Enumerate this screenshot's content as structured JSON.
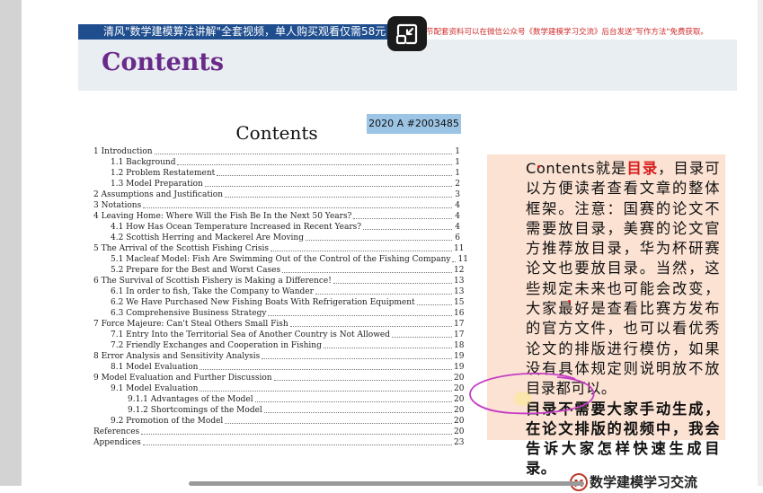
{
  "banner": {
    "text": "清风\"数学建模算法讲解\"全套视频，单人购买观看仅需58元",
    "note": "节配套资料可以在微信公众号《数学建模学习交流》后台发送\"写作方法\"免费获取。"
  },
  "slide": {
    "title": "Contents",
    "badge": "2020 A #2003485",
    "doc_title": "Contents"
  },
  "toc": [
    {
      "text": "1 Introduction",
      "page": "1",
      "level": 0
    },
    {
      "text": "1.1 Background",
      "page": "1",
      "level": 1
    },
    {
      "text": "1.2 Problem Restatement",
      "page": "1",
      "level": 1
    },
    {
      "text": "1.3 Model Preparation",
      "page": "2",
      "level": 1
    },
    {
      "text": "2 Assumptions and Justification",
      "page": "3",
      "level": 0
    },
    {
      "text": "3 Notations",
      "page": "4",
      "level": 0
    },
    {
      "text": "4 Leaving Home: Where Will the Fish Be In the Next 50 Years?",
      "page": "4",
      "level": 0
    },
    {
      "text": "4.1 How Has Ocean Temperature Increased in Recent Years?",
      "page": "4",
      "level": 1
    },
    {
      "text": "4.2 Scottish Herring and Mackerel Are Moving",
      "page": "6",
      "level": 1
    },
    {
      "text": "5 The Arrival of the Scottish Fishing Crisis",
      "page": "11",
      "level": 0
    },
    {
      "text": "5.1 Macleaf Model: Fish Are Swimming Out of the Control of the Fishing Company",
      "page": "11",
      "level": 1
    },
    {
      "text": "5.2 Prepare for the Best and Worst Cases",
      "page": "12",
      "level": 1
    },
    {
      "text": "6 The Survival of Scottish Fishery is Making a Difference!",
      "page": "13",
      "level": 0
    },
    {
      "text": "6.1 In order to fish, Take the Company to Wander",
      "page": "13",
      "level": 1
    },
    {
      "text": "6.2 We Have Purchased New Fishing Boats With Refrigeration Equipment",
      "page": "15",
      "level": 1
    },
    {
      "text": "6.3 Comprehensive Business Strategy",
      "page": "16",
      "level": 1
    },
    {
      "text": "7 Force Majeure: Can't Steal Others Small Fish",
      "page": "17",
      "level": 0
    },
    {
      "text": "7.1 Entry Into the Territorial Sea of Another Country is Not Allowed",
      "page": "17",
      "level": 1
    },
    {
      "text": "7.2 Friendly Exchanges and Cooperation in Fishing",
      "page": "18",
      "level": 1
    },
    {
      "text": "8 Error Analysis and Sensitivity Analysis",
      "page": "19",
      "level": 0
    },
    {
      "text": "8.1 Model Evaluation",
      "page": "19",
      "level": 1
    },
    {
      "text": "9 Model Evaluation and Further Discussion",
      "page": "20",
      "level": 0
    },
    {
      "text": "9.1 Model Evaluation",
      "page": "20",
      "level": 1
    },
    {
      "text": "9.1.1 Advantages of the Model",
      "page": "20",
      "level": 2
    },
    {
      "text": "9.1.2 Shortcomings of the Model",
      "page": "20",
      "level": 2
    },
    {
      "text": "9.2 Promotion of the Model",
      "page": "20",
      "level": 1
    },
    {
      "text": "References",
      "page": "20",
      "level": 0
    },
    {
      "text": "Appendices",
      "page": "23",
      "level": 0
    }
  ],
  "note": {
    "p1_lead": "Contents就是",
    "p1_keyword": "目录",
    "p1_rest": "，目录可以方便读者查看文章的整体框架。注意：国赛的论文不需要放目录，美赛的论文官方推荐放目录，华为杯研赛论文也要放目录。当然，这些规定未来也可能会改变，大家最好是查看比赛方发布的官方文件，也可以看优秀论文的排版进行模仿，如果没有具体规定则说明放不放目录都可以。",
    "p2": "目录不需要大家手动生成，在论文排版的视频中，我会告诉大家怎样快速生成目录。"
  },
  "footer": {
    "logo_text": "数学建模学习交流"
  },
  "colors": {
    "banner_bg": "#1f4e8f",
    "title": "#6a2a8a",
    "badge_bg": "#9cc4e4",
    "note_bg": "#fbe2d3",
    "keyword": "#d71f1f",
    "annotation": "#c63dc6"
  },
  "icons": {
    "pip": "exit-picture-in-picture-icon",
    "logo": "logo-mark-icon"
  }
}
